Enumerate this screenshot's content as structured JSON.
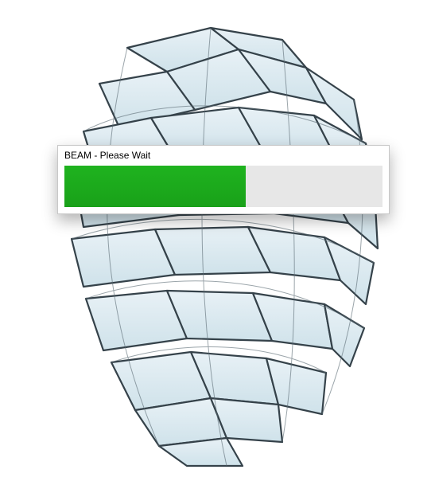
{
  "dialog": {
    "title": "BEAM - Please Wait",
    "progress_percent": 57,
    "progress_color": "#19a119",
    "track_color": "#e7e7e7"
  }
}
